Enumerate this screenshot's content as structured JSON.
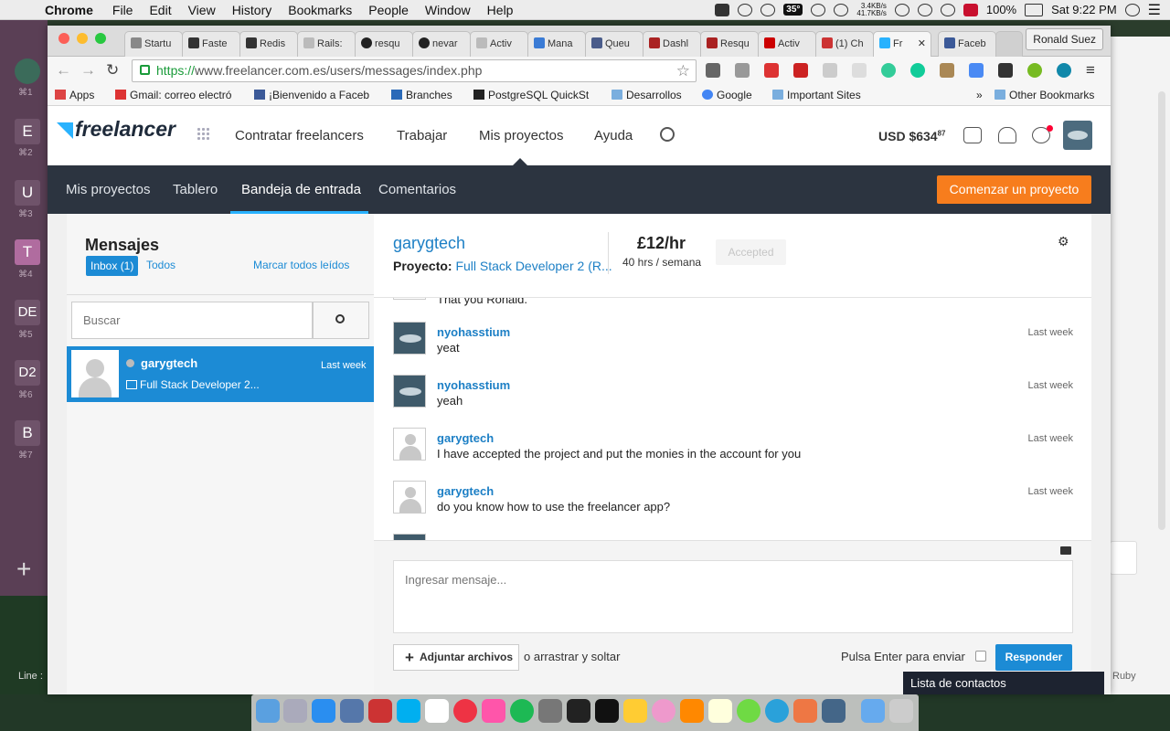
{
  "menubar": {
    "app": "Chrome",
    "items": [
      "File",
      "Edit",
      "View",
      "History",
      "Bookmarks",
      "People",
      "Window",
      "Help"
    ],
    "temperature": "35°",
    "net_up": "3.4KB/s",
    "net_down": "41.7KB/s",
    "battery": "100%",
    "clock": "Sat 9:22 PM"
  },
  "dock_left": {
    "items": [
      {
        "letter": "E",
        "key": "⌘2"
      },
      {
        "letter": "U",
        "key": "⌘3"
      },
      {
        "letter": "T",
        "key": "⌘4"
      },
      {
        "letter": "DE",
        "key": "⌘5"
      },
      {
        "letter": "D2",
        "key": "⌘6"
      },
      {
        "letter": "B",
        "key": "⌘7"
      }
    ],
    "first_key": "⌘1",
    "bottom_label": "Line :"
  },
  "browser": {
    "tabs": [
      "Startu",
      "Faste",
      "Redis",
      "Rails:",
      "resqu",
      "nevar",
      "Activ",
      "Mana",
      "Queu",
      "Dashl",
      "Resqu",
      "Activ",
      "(1) Ch",
      "Fr",
      "Faceb"
    ],
    "profile": "Ronald Suez",
    "url_scheme": "https://",
    "url_rest": "www.freelancer.com.es/users/messages/index.php",
    "bookmarks": [
      "Apps",
      "Gmail: correo electró",
      "¡Bienvenido a Faceb",
      "Branches",
      "PostgreSQL QuickSt",
      "Desarrollos",
      "Google",
      "Important Sites",
      "»",
      "Other Bookmarks"
    ]
  },
  "header": {
    "logo": "freelancer",
    "nav": [
      "Contratar freelancers",
      "Trabajar",
      "Mis proyectos",
      "Ayuda"
    ],
    "balance": "USD $634",
    "balance_cents": "87"
  },
  "subnav": {
    "items": [
      "Mis proyectos",
      "Tablero",
      "Bandeja de entrada",
      "Comentarios"
    ],
    "active_index": 2,
    "cta": "Comenzar un proyecto"
  },
  "inbox": {
    "title": "Mensajes",
    "inbox_tab": "Inbox (1)",
    "all_tab": "Todos",
    "mark_all": "Marcar todos leídos",
    "search_placeholder": "Buscar",
    "thread": {
      "name": "garygtech",
      "time": "Last week",
      "project": "Full Stack Developer 2..."
    }
  },
  "conversation": {
    "user": "garygtech",
    "project_label": "Proyecto:",
    "project": "Full Stack Developer 2 (R...",
    "rate": "£12/hr",
    "hours": "40 hrs / semana",
    "status": "Accepted",
    "partial_top_text": "That you Ronald.",
    "messages": [
      {
        "name": "nyohasstium",
        "text": "yeat",
        "time": "Last week",
        "avatar": "ufo"
      },
      {
        "name": "nyohasstium",
        "text": "yeah",
        "time": "Last week",
        "avatar": "ufo"
      },
      {
        "name": "garygtech",
        "text": "I have accepted the project and put the monies in the account for you",
        "time": "Last week",
        "avatar": "generic"
      },
      {
        "name": "garygtech",
        "text": "do you know how to use the freelancer app?",
        "time": "Last week",
        "avatar": "generic"
      }
    ],
    "compose_placeholder": "Ingresar mensaje...",
    "attach": "Adjuntar archivos",
    "drag": "o arrastrar y soltar",
    "enter_label": "Pulsa Enter para enviar",
    "reply": "Responder"
  },
  "contacts": "Lista de contactos",
  "background_label": "Ruby",
  "colors": {
    "accent": "#1c8bd5",
    "cta": "#f77d1d",
    "subnav": "#2c3440",
    "logo_bird": "#29b2fe"
  }
}
